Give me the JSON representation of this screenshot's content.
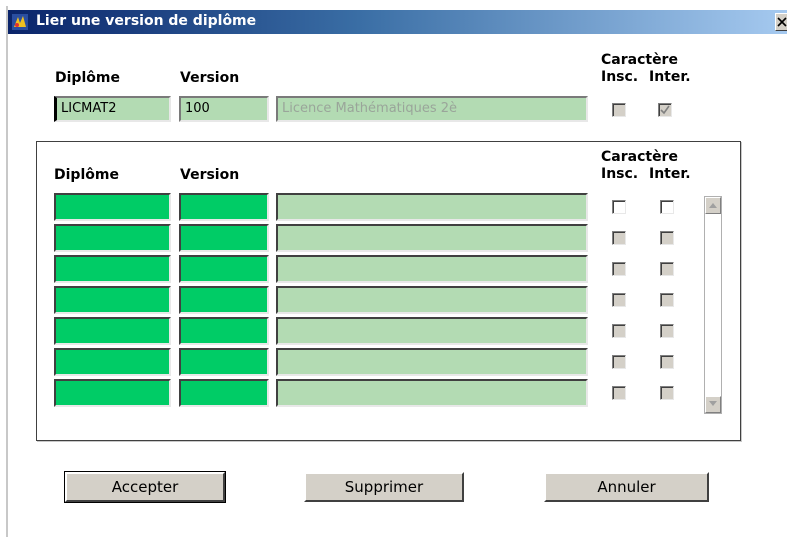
{
  "window": {
    "title": "Lier une version de diplôme"
  },
  "header": {
    "diplome_label": "Diplôme",
    "version_label": "Version",
    "caractere_label": "Caractère",
    "insc_label": "Insc.",
    "inter_label": "Inter.",
    "diplome_value": "LICMAT2",
    "version_value": "100",
    "libelle_value": "Licence Mathématiques 2è",
    "insc_checked": false,
    "inter_checked": true
  },
  "grid": {
    "diplome_label": "Diplôme",
    "version_label": "Version",
    "caractere_label": "Caractère",
    "insc_label": "Insc.",
    "inter_label": "Inter.",
    "rows": [
      {
        "diplome": "",
        "version": "",
        "libelle": "",
        "insc": false,
        "inter": false
      },
      {
        "diplome": "",
        "version": "",
        "libelle": "",
        "insc": false,
        "inter": false
      },
      {
        "diplome": "",
        "version": "",
        "libelle": "",
        "insc": false,
        "inter": false
      },
      {
        "diplome": "",
        "version": "",
        "libelle": "",
        "insc": false,
        "inter": false
      },
      {
        "diplome": "",
        "version": "",
        "libelle": "",
        "insc": false,
        "inter": false
      },
      {
        "diplome": "",
        "version": "",
        "libelle": "",
        "insc": false,
        "inter": false
      },
      {
        "diplome": "",
        "version": "",
        "libelle": "",
        "insc": false,
        "inter": false
      }
    ]
  },
  "buttons": {
    "accept_label": "Accepter",
    "delete_label": "Supprimer",
    "cancel_label": "Annuler"
  },
  "colors": {
    "titlebar": "#0a246a",
    "field_green": "#00cc66",
    "field_light": "#b3dbb3",
    "button_face": "#d4d0c8"
  }
}
